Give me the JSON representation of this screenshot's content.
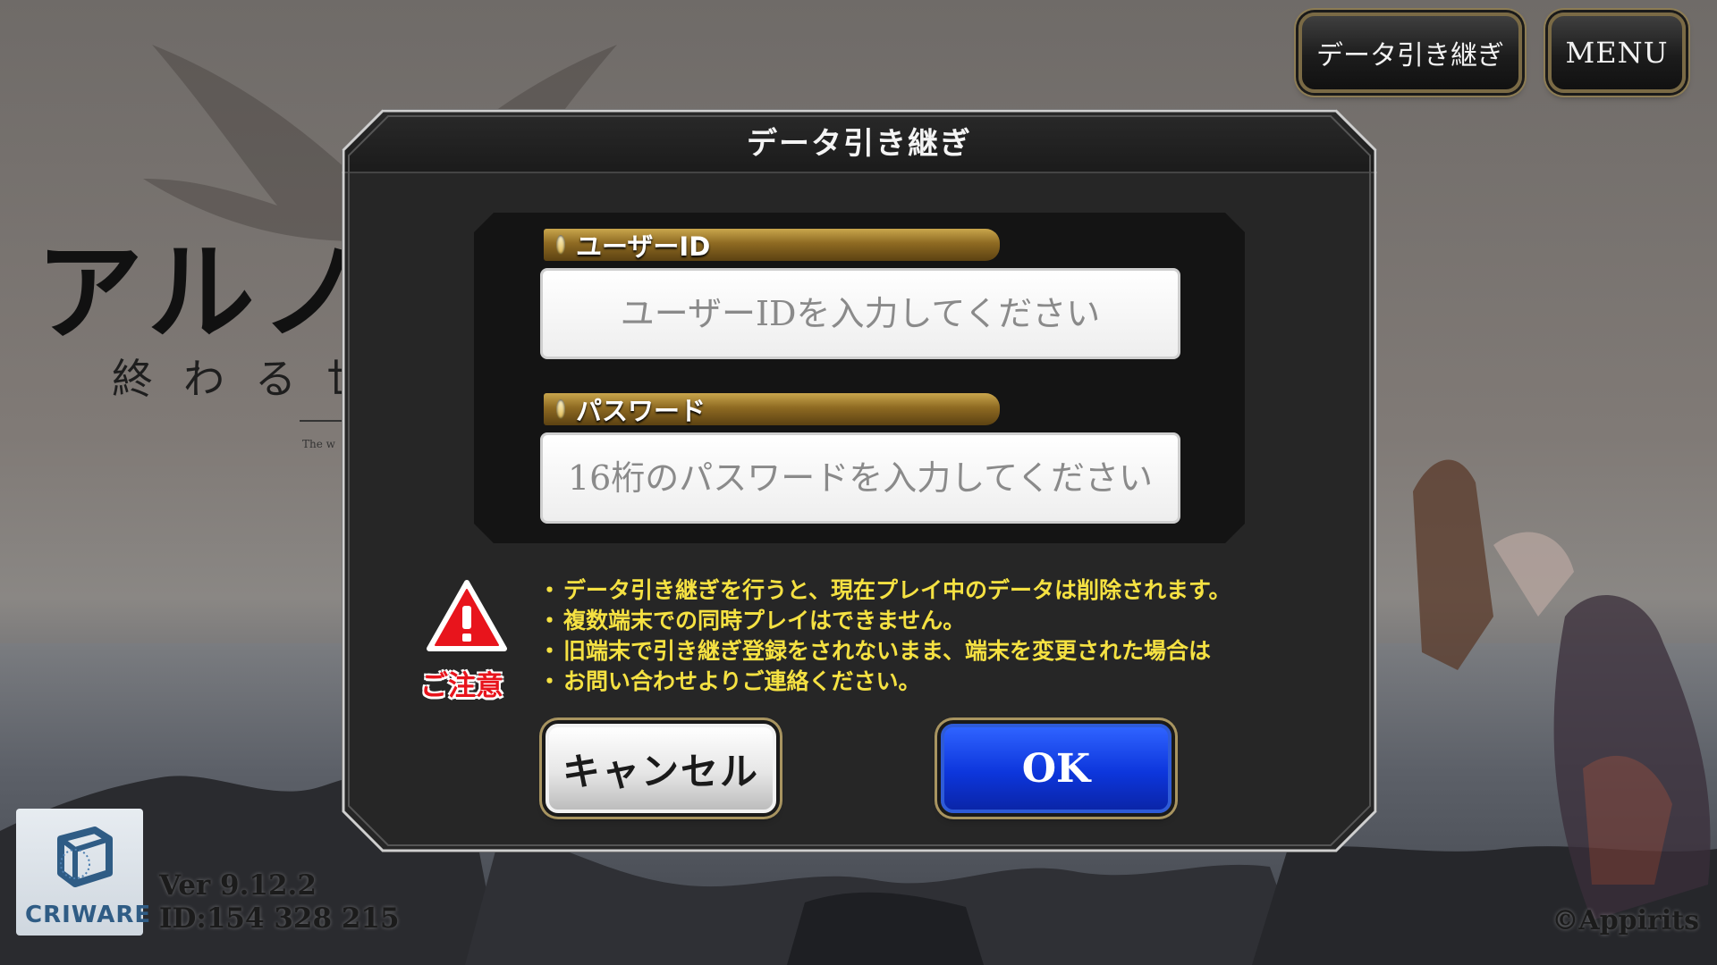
{
  "top_buttons": {
    "transfer_label": "データ引き継ぎ",
    "menu_label": "MENU"
  },
  "background": {
    "logo_title": "アルノ",
    "logo_subtitle": "終わる世",
    "logo_tiny": "The w"
  },
  "dialog": {
    "title": "データ引き継ぎ",
    "user_id": {
      "label": "ユーザーID",
      "value": "",
      "placeholder": "ユーザーIDを入力してください"
    },
    "password": {
      "label": "パスワード",
      "value": "",
      "placeholder": "16桁のパスワードを入力してください"
    },
    "notice": {
      "label": "ご注意",
      "items": [
        "データ引き継ぎを行うと、現在プレイ中のデータは削除されます。",
        "複数端末での同時プレイはできません。",
        "旧端末で引き継ぎ登録をされないまま、端末を変更された場合は",
        "お問い合わせよりご連絡ください。"
      ]
    },
    "cancel_label": "キャンセル",
    "ok_label": "OK"
  },
  "footer": {
    "criware": "CRIWARE",
    "version": "Ver 9.12.2",
    "id": "ID:154 328 215",
    "copyright": "©Appirits"
  },
  "colors": {
    "notice_text": "#f5e142",
    "warning_red": "#e8141c",
    "ok_blue": "#0d36dc",
    "label_gold": "#b08a35"
  },
  "icons": [
    "warning-icon",
    "criware-cube-icon",
    "label-gem-icon"
  ]
}
